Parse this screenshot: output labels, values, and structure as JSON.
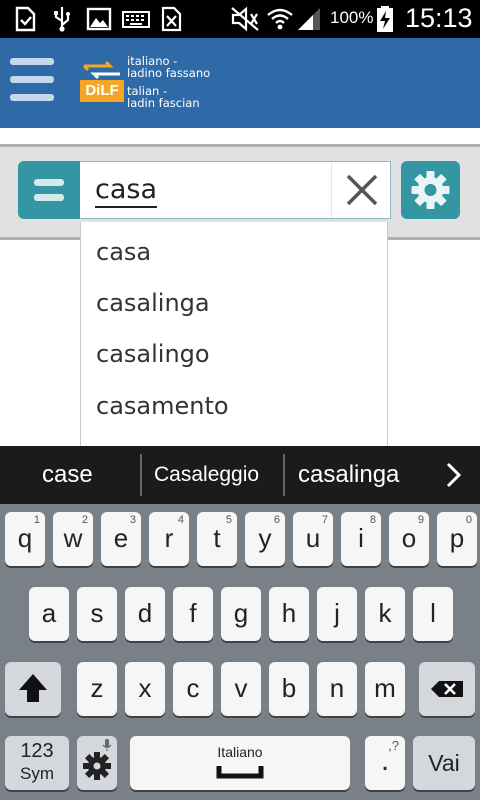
{
  "status_bar": {
    "battery_percent": "100%",
    "time": "15:13",
    "icons": [
      "sim-card-icon",
      "usb-icon",
      "image-icon",
      "keyboard-icon",
      "block-icon",
      "mute-icon",
      "wifi-icon",
      "signal-icon",
      "battery-charging-icon"
    ]
  },
  "app_bar": {
    "logo_lines": [
      "italiano -",
      "ladino fassano",
      "talian -",
      "ladin fascian"
    ],
    "logo_badge": "DiLF"
  },
  "search": {
    "query": "casa"
  },
  "suggestions": [
    "casa",
    "casalinga",
    "casalingo",
    "casamento"
  ],
  "predictions": [
    "case",
    "Casaleggio",
    "casalinga"
  ],
  "keyboard": {
    "row1": [
      {
        "label": "q",
        "num": "1"
      },
      {
        "label": "w",
        "num": "2"
      },
      {
        "label": "e",
        "num": "3"
      },
      {
        "label": "r",
        "num": "4"
      },
      {
        "label": "t",
        "num": "5"
      },
      {
        "label": "y",
        "num": "6"
      },
      {
        "label": "u",
        "num": "7"
      },
      {
        "label": "i",
        "num": "8"
      },
      {
        "label": "o",
        "num": "9"
      },
      {
        "label": "p",
        "num": "0"
      }
    ],
    "row2": [
      "a",
      "s",
      "d",
      "f",
      "g",
      "h",
      "j",
      "k",
      "l"
    ],
    "row3": [
      "z",
      "x",
      "c",
      "v",
      "b",
      "n",
      "m"
    ],
    "sym_label_top": "123",
    "sym_label_bottom": "Sym",
    "space_label": "Italiano",
    "period_label": ".",
    "period_hint": ",?",
    "go_label": "Vai"
  },
  "colors": {
    "app_bar": "#2f6aa8",
    "accent_teal": "#3396a2",
    "keyboard_bg": "#7a8087"
  }
}
